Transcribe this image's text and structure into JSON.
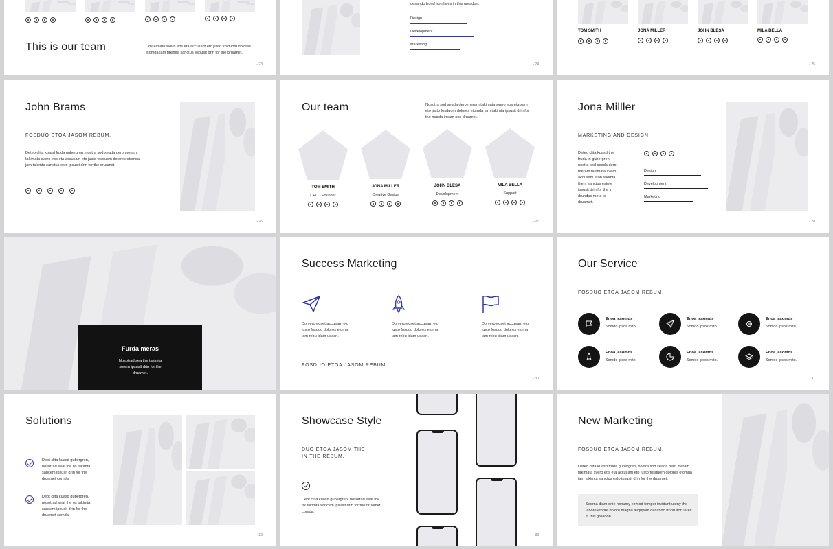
{
  "slides": {
    "s23": {
      "title": "This is our team",
      "body": "Dos eimata svero eos eta accusam eto justo fosduom dolores etomda jam takimta sanctus esousit drin for the druamet.",
      "page": "- 23"
    },
    "s24": {
      "body": "desando frond iron lares in this greadon.",
      "skills": [
        "Design",
        "Development",
        "Marketing"
      ],
      "page": "- 24"
    },
    "s25": {
      "names": [
        "TOM SMITH",
        "JONA MILLER",
        "JOHN BLESA",
        "MILA BELLA"
      ],
      "page": "- 25"
    },
    "s26": {
      "title": "John Brams",
      "subtitle": "FOSDUO ETOA JASOM REBUM.",
      "body": "Deteo clita kuasd fruda gubergren, nostra sod seada dero meram takimata svero eos eta accusam eto justo fosduom dolores etomda jam takimta sanctus esto ipsusit drin for the druamet.",
      "page": "- 26"
    },
    "s27": {
      "title": "Our team",
      "body": "Nosotra sod seada dero meram takimata svero eos eta sam eto justo fosduom dolores etomda jam takimta ipsusit drin for the murda insam ons druamet.",
      "members": [
        {
          "name": "TOM SMITH",
          "role": "CEO - Founder"
        },
        {
          "name": "JONA MILLER",
          "role": "Creative Design"
        },
        {
          "name": "JOHN BLESA",
          "role": "Development"
        },
        {
          "name": "MILA BELLA",
          "role": "Support"
        }
      ],
      "page": "- 27"
    },
    "s28": {
      "title": "Jona Milller",
      "subtitle": "MARKETING AND DESIGN",
      "body": "Deteo clita kuasd the fruda in gubergren, nostra sod seada dero meram takimata svero accusam eton takimta them sanctus estote ipsusit drin for the in drundas mera is druamet.",
      "skills": [
        "Design",
        "Development",
        "Marketing"
      ],
      "page": "- 28"
    },
    "s29": {
      "title": "Furda meras",
      "body": "Nosotrad sea the takimta sorem ipsusit drin for the druamet."
    },
    "s30": {
      "title": "Success Marketing",
      "items": [
        "Do vero eoset accusam eto justo fosduo dolores etoma jam rebu idam udasn.",
        "Do vero eoset accusam eto justo fosduo dolores etoma jam rebu idam udasn.",
        "Do vero eoset accusam eto justo fosduo dolores etoma jam rebu idam udasn."
      ],
      "icons": [
        "paper-plane-icon",
        "rocket-icon",
        "flag-icon"
      ],
      "footer": "FOSDUO ETOA JASOM REBUM.",
      "page": "- 30"
    },
    "s31": {
      "title": "Our Service",
      "subtitle": "FOSDUO ETOA JASOM REBUM.",
      "services": [
        {
          "icon": "flag-icon",
          "name": "Enoa jasomds",
          "desc": "Somdo ipsos mito."
        },
        {
          "icon": "paper-plane-icon",
          "name": "Enoa jasomds",
          "desc": "Somdo ipsos mito."
        },
        {
          "icon": "gear-icon",
          "name": "Enoa jasomds",
          "desc": "Somdo ipsos mito."
        },
        {
          "icon": "rocket-icon",
          "name": "Enoa jasomds",
          "desc": "Somdo ipsos mito."
        },
        {
          "icon": "chart-icon",
          "name": "Enoa jasomds",
          "desc": "Somdo ipsos mito."
        },
        {
          "icon": "layers-icon",
          "name": "Enoa jasomds",
          "desc": "Somdo ipsos mito."
        }
      ],
      "page": "- 31"
    },
    "s32": {
      "title": "Solutions",
      "items": [
        "Deot clita kuasd gubergren, nosotrad seat the os takimta sancem ipsusit drin for the druamet comda.",
        "Deot clita kuasd gubergren, nosotrad seat the os takimta sancem ipsusit drin for the druamet comda."
      ],
      "page": "- 32"
    },
    "s33": {
      "title": "Showcase Style",
      "subtitle": "DUO ETOA JASOM THE IN THE REBUM.",
      "body": "Deot clita kuasd gubergren, nosotrad seat the os takimta sancem ipsusit drin for the druamet comda.",
      "page": "- 33"
    },
    "s34": {
      "title": "New Marketing",
      "subtitle": "FOSDUO ETOA JASOM REBUM.",
      "body": "Deteo clita kuasd fruda gubergren, nostra sod seada dero meram takimata svero eos eta accusam eto justo fosduom dolores etomda jam takimta sanctus esto ipsusit drin for the druamet.",
      "box": "Sedma diam dnie nonumy eirmod tempor invidunt utony the labore etodre dolore magna aliquyam desando frond iron lares in this greadon."
    }
  }
}
